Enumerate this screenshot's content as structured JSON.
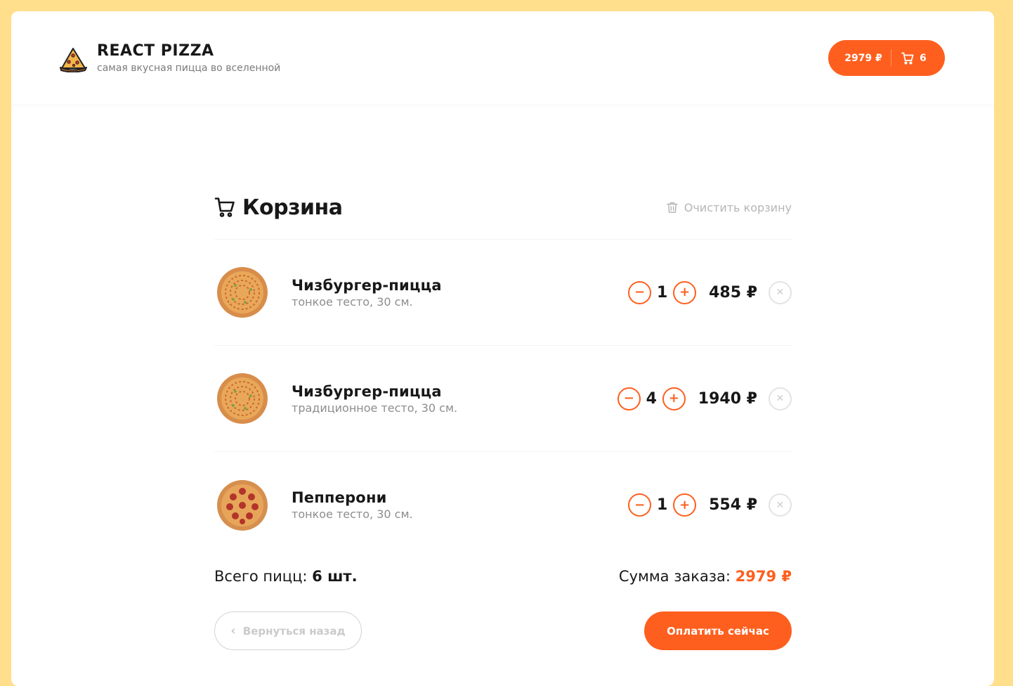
{
  "header": {
    "logo_title": "REACT PIZZA",
    "logo_subtitle": "самая вкусная пицца во вселенной",
    "cart_price": "2979 ₽",
    "cart_count": "6"
  },
  "cart": {
    "title": "Корзина",
    "clear_label": "Очистить корзину",
    "items": [
      {
        "name": "Чизбургер-пицца",
        "desc": "тонкое тесто, 30 см.",
        "qty": "1",
        "price": "485 ₽",
        "image": "cheeseburger-pizza"
      },
      {
        "name": "Чизбургер-пицца",
        "desc": "традиционное тесто, 30 см.",
        "qty": "4",
        "price": "1940 ₽",
        "image": "cheeseburger-pizza"
      },
      {
        "name": "Пепперони",
        "desc": "тонкое тесто, 30 см.",
        "qty": "1",
        "price": "554 ₽",
        "image": "pepperoni-pizza"
      }
    ],
    "total_count_label": "Всего пицц:",
    "total_count_value": "6 шт.",
    "total_sum_label": "Сумма заказа:",
    "total_sum_value": "2979 ₽",
    "back_label": "Вернуться назад",
    "pay_label": "Оплатить сейчас"
  },
  "colors": {
    "accent": "#fe5f1e",
    "background": "#ffdf8c"
  }
}
